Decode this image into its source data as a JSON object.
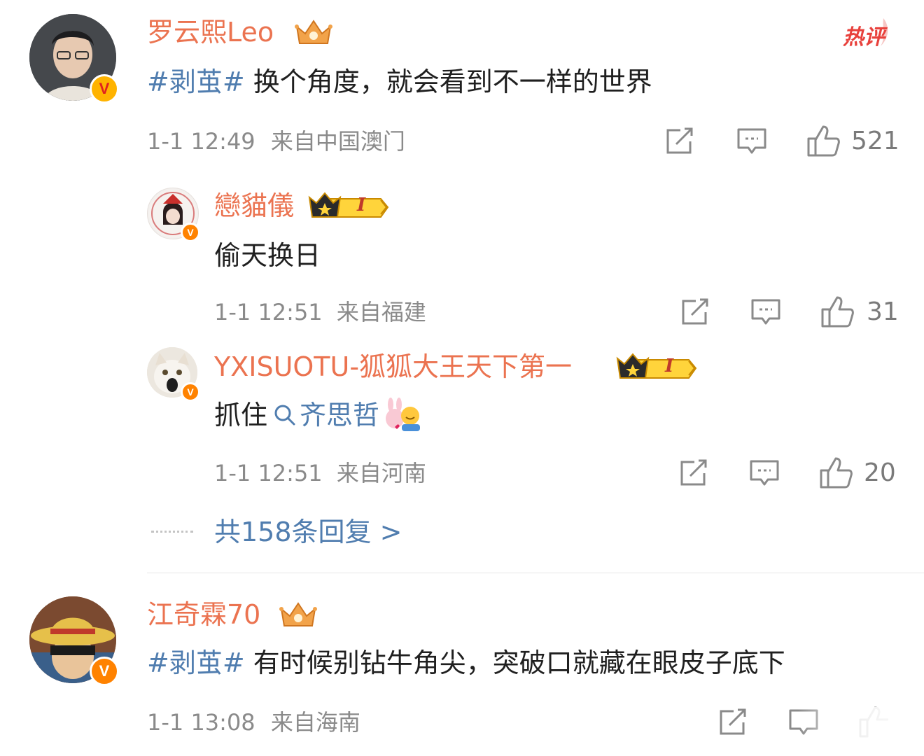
{
  "colors": {
    "name": "#eb7350",
    "topic": "#507daf",
    "meta": "#8a8a8a",
    "verified": "#ff8200",
    "hot": "#e8413c"
  },
  "hot_tag": "热评",
  "comments": [
    {
      "user": "罗云熙Leo",
      "badge_icon": "crown-icon",
      "topic": "#剥茧#",
      "text": "换个角度，就会看到不一样的世界",
      "time": "1-1 12:49",
      "location": "来自中国澳门",
      "likes": "521",
      "replies": [
        {
          "user": "戀貓儀",
          "badge_icon": "crown-icon",
          "level": "I",
          "text": "偷天换日",
          "time": "1-1 12:51",
          "location": "来自福建",
          "likes": "31"
        },
        {
          "user": "YXISUOTU-狐狐大王天下第一",
          "badge_icon": "crown-icon",
          "level": "I",
          "text": "抓住",
          "search_link": "齐思哲",
          "emoji_icon": "bunny-hug-emoji",
          "time": "1-1 12:51",
          "location": "来自河南",
          "likes": "20"
        }
      ],
      "more_replies": "共158条回复 >"
    },
    {
      "user": "江奇霖70",
      "badge_icon": "crown-icon",
      "topic": "#剥茧#",
      "text": "有时候别钻牛角尖，突破口就藏在眼皮子底下",
      "time": "1-1 13:08",
      "location": "来自海南"
    }
  ]
}
